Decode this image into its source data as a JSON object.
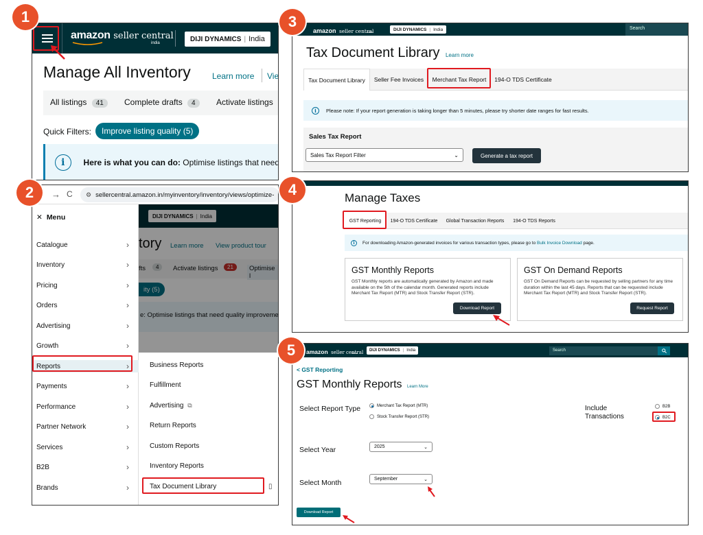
{
  "colors": {
    "accent": "#e0191f",
    "badge": "#e8512a",
    "seller_bar": "#002f36",
    "dark_button": "#23333c",
    "teal_pill": "#007185",
    "info_bg": "#eaf6fb"
  },
  "steps": [
    "1",
    "2",
    "3",
    "4",
    "5"
  ],
  "brand": {
    "logo_main": "amazon",
    "logo_sub": "seller central",
    "logo_region": "india"
  },
  "store": {
    "name": "DIJI DYNAMICS",
    "marketplace": "India"
  },
  "panel1": {
    "menu_icon": "hamburger-icon",
    "page_title": "Manage All Inventory",
    "learn_more": "Learn more",
    "view_partial": "Vie",
    "tabs": [
      {
        "label": "All listings",
        "count": "41"
      },
      {
        "label": "Complete drafts",
        "count": "4"
      },
      {
        "label": "Activate listings",
        "count": ""
      }
    ],
    "quick_filters_label": "Quick Filters:",
    "quick_filter_pill": "Improve listing quality (5)",
    "notice_bold": "Here is what you can do:",
    "notice_text": " Optimise listings that need"
  },
  "panel2": {
    "url": "sellercentral.amazon.in/myinventory/inventory/views/optimize-",
    "menu_title": "Menu",
    "menu_items": [
      "Catalogue",
      "Inventory",
      "Pricing",
      "Orders",
      "Advertising",
      "Growth",
      "Reports",
      "Payments",
      "Performance",
      "Partner Network",
      "Services",
      "B2B",
      "Brands"
    ],
    "active_item": "Reports",
    "submenu_items": [
      "Business Reports",
      "Fulfillment",
      "Advertising",
      "Return Reports",
      "Custom Reports",
      "Inventory Reports",
      "Tax Document Library"
    ],
    "bg": {
      "title_part": "tory",
      "learn_more": "Learn more",
      "tour": "View product tour",
      "drafts_part": "fts",
      "drafts_count": "4",
      "activate": "Activate listings",
      "activate_count": "21",
      "optimise_part": "Optimise l",
      "pill_part": "ity (5)",
      "notice_part": "e: Optimise listings that need quality improveme"
    }
  },
  "panel3": {
    "search_placeholder": "Search",
    "title": "Tax Document Library",
    "learn_more": "Learn more",
    "tabs": [
      "Tax Document Library",
      "Seller Fee Invoices",
      "Merchant Tax Report",
      "194-O TDS Certificate"
    ],
    "notice": "Please note: If your report generation is taking longer than 5 minutes, please try shorter date ranges for fast results.",
    "section": "Sales Tax Report",
    "filter_placeholder": "Sales Tax Report Filter",
    "generate_button": "Generate a tax report"
  },
  "panel4": {
    "title": "Manage Taxes",
    "tabs": [
      "GST Reporting",
      "194-O TDS Certificate",
      "Global Transaction Reports",
      "194-O TDS Reports"
    ],
    "notice_pre": "For downloading Amazon-generated invoices for various transaction types, please go to ",
    "notice_link": "Bulk Invoice Download",
    "notice_post": " page.",
    "card1": {
      "title": "GST Monthly Reports",
      "text": "GST Monthly reports are automatically generated by Amazon and made available on the 5th of the calendar month. Generated reports include Merchant Tax Report (MTR) and Stock Transfer Report (STR).",
      "button": "Download Report"
    },
    "card2": {
      "title": "GST On Demand Reports",
      "text": "GST On Demand Reports can be requested by selling partners for any time duration within the last 45 days. Reports that can be requested include Merchant Tax Report (MTR) and Stock Transfer Report (STR).",
      "button": "Request Report"
    }
  },
  "panel5": {
    "search_placeholder": "Search",
    "back_link": "< GST Reporting",
    "title": "GST Monthly Reports",
    "learn_more": "Learn More",
    "report_type_label": "Select Report Type",
    "report_types": [
      "Merchant Tax Report (MTR)",
      "Stock Transfer Report (STR)"
    ],
    "selected_report_type": "Merchant Tax Report (MTR)",
    "include_label_1": "Include",
    "include_label_2": "Transactions",
    "include_options": [
      "B2B",
      "B2C"
    ],
    "selected_include": "B2C",
    "year_label": "Select Year",
    "year_value": "2025",
    "month_label": "Select Month",
    "month_value": "September",
    "download_button": "Download Report"
  }
}
